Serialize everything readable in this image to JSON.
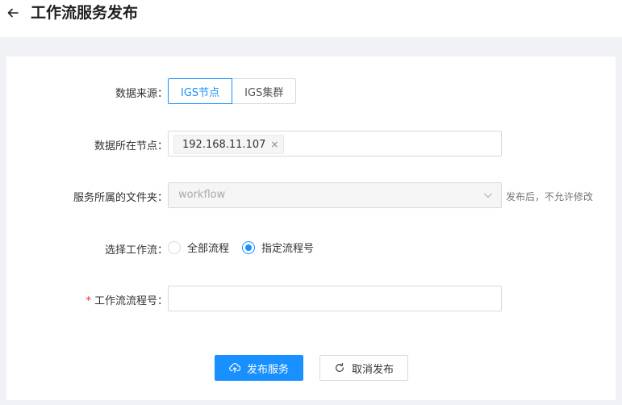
{
  "header": {
    "title": "工作流服务发布",
    "back_icon": "arrow-left-icon"
  },
  "form": {
    "data_source": {
      "label": "数据来源：",
      "options": [
        "IGS节点",
        "IGS集群"
      ],
      "selected": "IGS节点"
    },
    "node": {
      "label": "数据所在节点：",
      "tag": "192.168.11.107",
      "tag_close": "×"
    },
    "folder": {
      "label": "服务所属的文件夹：",
      "value": "workflow",
      "hint": "发布后，不允许修改"
    },
    "workflow_select": {
      "label": "选择工作流：",
      "options": [
        "全部流程",
        "指定流程号"
      ],
      "selected": "指定流程号"
    },
    "workflow_id": {
      "required_mark": "*",
      "label": "工作流流程号：",
      "value": "",
      "placeholder": ""
    }
  },
  "actions": {
    "publish_label": "发布服务",
    "cancel_label": "取消发布"
  },
  "colors": {
    "primary": "#1890ff",
    "required": "#f5222d",
    "border": "#d9d9d9",
    "background": "#f0f2f5"
  }
}
